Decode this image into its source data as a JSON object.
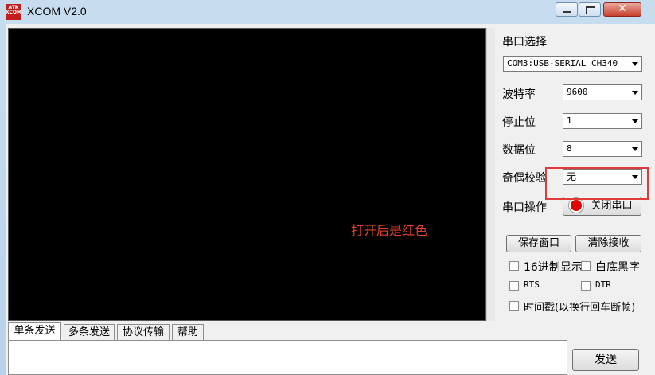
{
  "window": {
    "title": "XCOM V2.0",
    "logo_text": "ATK\nXCOM",
    "close_glyph": "✕"
  },
  "receive": {
    "annotation": "打开后是红色"
  },
  "settings": {
    "port_label": "串口选择",
    "port_value": "COM3:USB-SERIAL CH340",
    "baud_label": "波特率",
    "baud_value": "9600",
    "stopbits_label": "停止位",
    "stopbits_value": "1",
    "databits_label": "数据位",
    "databits_value": "8",
    "parity_label": "奇偶校验",
    "parity_value": "无",
    "operation_label": "串口操作",
    "open_close_button": "关闭串口"
  },
  "actions": {
    "save_window": "保存窗口",
    "clear_receive": "清除接收"
  },
  "options": {
    "hex_display": "16进制显示",
    "white_bg_black_text": "白底黑字",
    "rts": "RTS",
    "dtr": "DTR",
    "timestamp": "时间戳(以换行回车断帧)"
  },
  "tabs": [
    "单条发送",
    "多条发送",
    "协议传输",
    "帮助"
  ],
  "send": {
    "button": "发送"
  },
  "colors": {
    "led_on": "#e00000",
    "annotation": "#e0402a",
    "highlight_box": "#e03a3a"
  }
}
